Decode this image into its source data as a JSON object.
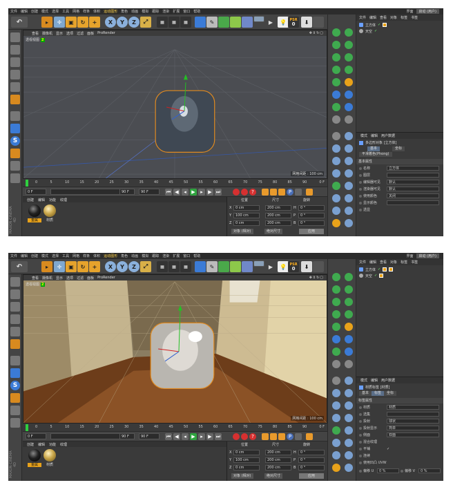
{
  "menu": [
    "文件",
    "编辑",
    "创建",
    "模式",
    "选择",
    "工具",
    "网格",
    "样条",
    "体积",
    "运动图形",
    "角色",
    "动画",
    "模拟",
    "跟踪",
    "渲染",
    "扩展",
    "窗口",
    "帮助"
  ],
  "menu_hl_index": 3,
  "layout": {
    "label": "界面",
    "value": "启动 (用户)"
  },
  "psr": {
    "label": "PSR",
    "value": "0"
  },
  "viewport_menu": [
    "查看",
    "摄像机",
    "显示",
    "选项",
    "过滤",
    "面板",
    "ProRender"
  ],
  "viewport_label": "透视视图",
  "viewport_marker": "2",
  "grid_distance": "网格间距 : 100 cm",
  "timeline_ticks": [
    "0",
    "5",
    "10",
    "15",
    "20",
    "25",
    "30",
    "35",
    "40",
    "45",
    "50",
    "55",
    "60",
    "65",
    "70",
    "75",
    "80",
    "85",
    "90"
  ],
  "timeline_end": "0 F",
  "transport": {
    "start": "0 F",
    "current": "0 F",
    "end": "90 F",
    "max": "90 F"
  },
  "material_tabs": [
    "创建",
    "编辑",
    "功能",
    "纹理"
  ],
  "materials": [
    {
      "name": "金属"
    },
    {
      "name": "材质"
    }
  ],
  "coords": {
    "headers": [
      "位置",
      "尺寸",
      "旋转"
    ],
    "rows": [
      {
        "axis": "X",
        "pos": "0 cm",
        "size": "200 cm",
        "rlabel": "H",
        "rot": "0 °"
      },
      {
        "axis": "Y",
        "pos": "100 cm",
        "size": "200 cm",
        "rlabel": "P",
        "rot": "0 °"
      },
      {
        "axis": "Z",
        "pos": "0 cm",
        "size": "200 cm",
        "rlabel": "B",
        "rot": "0 °"
      }
    ],
    "mode": "对象 (相对)",
    "size_mode": "绝对尺寸",
    "apply": "应用"
  },
  "object_menu": [
    "文件",
    "编辑",
    "查看",
    "对象",
    "标签",
    "书签"
  ],
  "objects": [
    {
      "name": "立方体"
    },
    {
      "name": "天空"
    }
  ],
  "attr_menu": [
    "模式",
    "编辑",
    "用户数据"
  ],
  "screens": [
    {
      "attr_title": "多边形对象 [立方体]",
      "tabs": [
        "基本",
        "坐标"
      ],
      "active_tab": 0,
      "phong": "平滑着色(Phong)",
      "section": "基本属性",
      "rows": [
        {
          "label": "名称",
          "value": "立方体"
        },
        {
          "label": "图层",
          "value": ""
        },
        {
          "label": "编辑器可见",
          "value": "默认"
        },
        {
          "label": "渲染器可见",
          "value": "默认"
        },
        {
          "label": "使用颜色",
          "value": "关闭"
        },
        {
          "label": "显示颜色",
          "value": ""
        },
        {
          "label": "透显",
          "value": ""
        }
      ]
    },
    {
      "attr_title": "材质标签 [材质]",
      "tabs": [
        "基本",
        "标签",
        "坐标"
      ],
      "active_tab": 1,
      "section": "标签属性",
      "rows": [
        {
          "label": "材质",
          "value": "材质"
        },
        {
          "label": "选集",
          "value": ""
        },
        {
          "label": "投射",
          "value": "球状"
        },
        {
          "label": "投射显示",
          "value": "简单"
        },
        {
          "label": "侧面",
          "value": "双面"
        },
        {
          "label": "混合纹理",
          "value": ""
        },
        {
          "label": "平铺",
          "value": "✓"
        },
        {
          "label": "连续",
          "value": ""
        },
        {
          "label": "使用凹凸 UVW",
          "value": ""
        },
        {
          "label": "偏移 U",
          "value": "0 %"
        },
        {
          "label": "偏移 V",
          "value": "0 %"
        }
      ]
    }
  ],
  "brand": "MAXON CINEMA 4D"
}
